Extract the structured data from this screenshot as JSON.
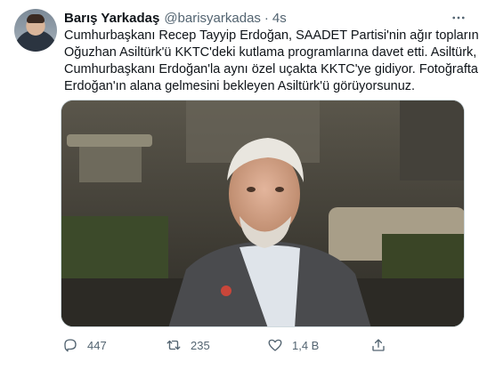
{
  "tweet": {
    "author_name": "Barış Yarkadaş",
    "author_handle": "@barisyarkadas",
    "separator": "·",
    "time": "4s",
    "text_lines": [
      "Cumhurbaşkanı Recep Tayyip Erdoğan, SAADET Partisi'nin ağır toplarından",
      "Oğuzhan Asiltürk'ü KKTC'deki kutlama programlarına davet etti. Asiltürk,",
      "Cumhurbaşkanı Erdoğan'la aynı özel uçakta KKTC'ye gidiyor. Fotoğrafta,",
      "Erdoğan'ın alana gelmesini bekleyen Asiltürk'ü görüyorsunuz."
    ]
  },
  "actions": {
    "reply_count": "447",
    "retweet_count": "235",
    "like_count": "1,4 B"
  },
  "icons": {
    "more": "more-horizontal-icon",
    "reply": "reply-icon",
    "retweet": "retweet-icon",
    "like": "heart-icon",
    "share": "share-icon"
  },
  "colors": {
    "text": "#0f1419",
    "secondary": "#536471",
    "border": "#cfd9de"
  }
}
